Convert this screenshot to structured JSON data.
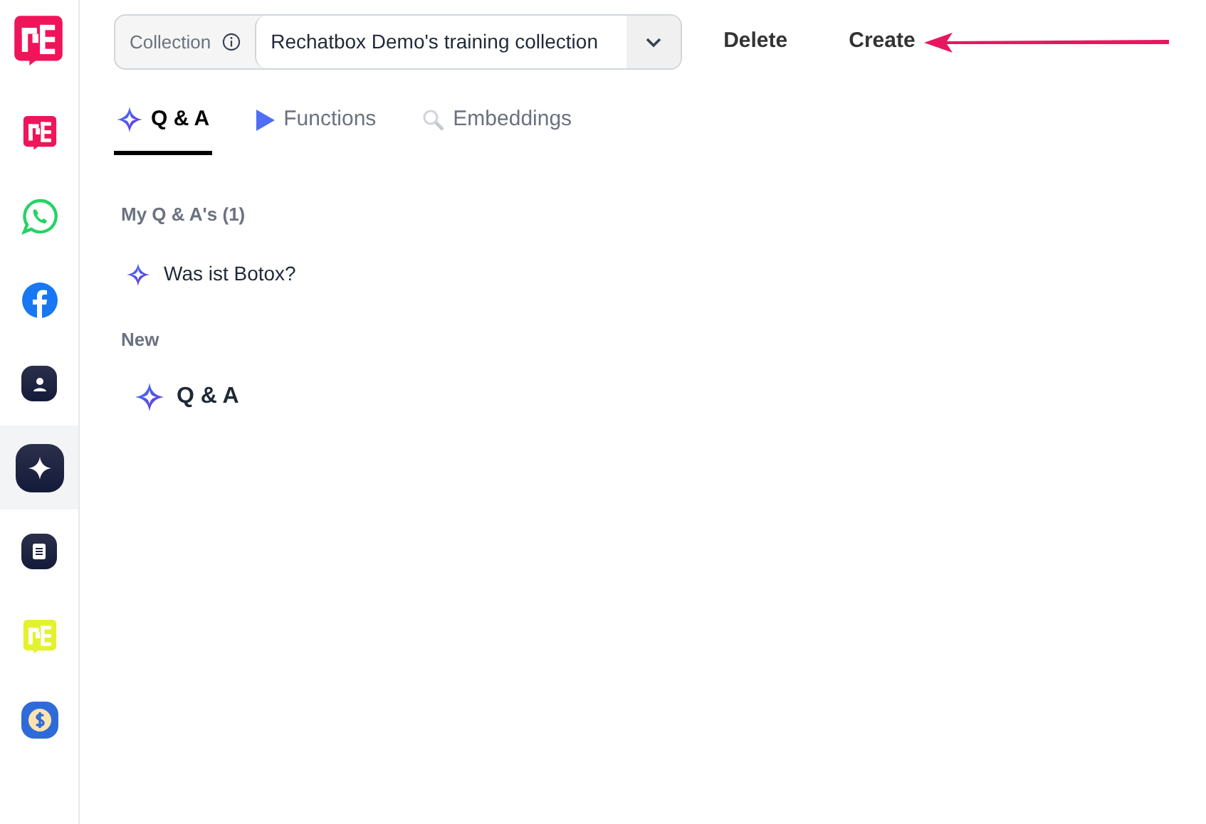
{
  "sidebar": {
    "items": [
      {
        "kind": "brand",
        "selected": false
      },
      {
        "kind": "whatsapp",
        "selected": false
      },
      {
        "kind": "facebook",
        "selected": false
      },
      {
        "kind": "contact",
        "selected": false
      },
      {
        "kind": "sparkle",
        "selected": true
      },
      {
        "kind": "document",
        "selected": false
      },
      {
        "kind": "brand-lime",
        "selected": false
      },
      {
        "kind": "dollar",
        "selected": false
      }
    ]
  },
  "toolbar": {
    "collection_label": "Collection",
    "collection_value": "Rechatbox Demo's training collection",
    "actions": [
      "Delete",
      "Create"
    ]
  },
  "tabs": [
    {
      "label": "Q & A",
      "kind": "sparkle",
      "selected": true
    },
    {
      "label": "Functions",
      "kind": "play",
      "selected": false
    },
    {
      "label": "Embeddings",
      "kind": "search",
      "selected": false
    }
  ],
  "sections": [
    {
      "title": "My Q & A's (1)",
      "kind": "list",
      "items": [
        "Was ist Botox?"
      ]
    },
    {
      "title": "New",
      "kind": "create",
      "items": [
        "Q & A"
      ]
    }
  ]
}
